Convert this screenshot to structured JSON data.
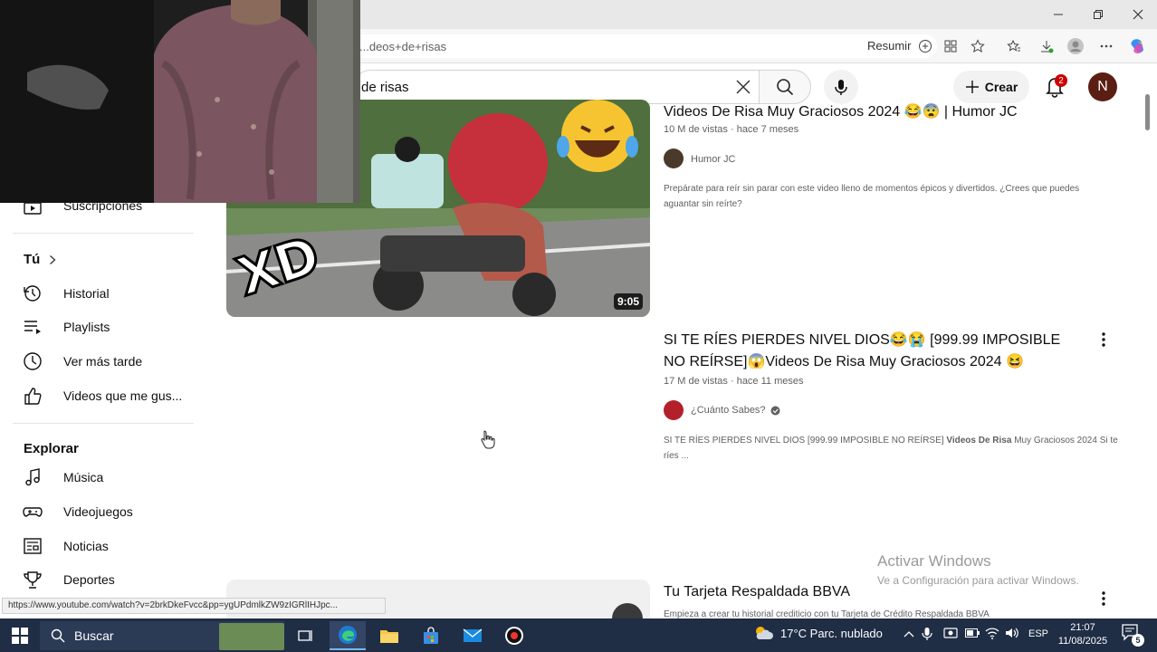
{
  "browser": {
    "url": "...deos+de+risas",
    "resume_label": "Resumir",
    "status_url": "https://www.youtube.com/watch?v=2brkDkeFvcc&pp=ygUPdmlkZW9zIGRlIHJpc..."
  },
  "header": {
    "search_value": "de risas",
    "create_label": "Crear",
    "notifications": "2",
    "avatar_letter": "N"
  },
  "sidebar": {
    "subscriptions_label": "Suscripciones",
    "you_heading": "Tú",
    "you_items": [
      {
        "label": "Historial",
        "icon": "history-icon"
      },
      {
        "label": "Playlists",
        "icon": "playlist-icon"
      },
      {
        "label": "Ver más tarde",
        "icon": "clock-icon"
      },
      {
        "label": "Videos que me gus...",
        "icon": "thumbs-up-icon"
      }
    ],
    "explore_heading": "Explorar",
    "explore_items": [
      {
        "label": "Música",
        "icon": "music-note-icon"
      },
      {
        "label": "Videojuegos",
        "icon": "gamepad-icon"
      },
      {
        "label": "Noticias",
        "icon": "newspaper-icon"
      },
      {
        "label": "Deportes",
        "icon": "trophy-icon"
      }
    ]
  },
  "videos": [
    {
      "title": "Videos De Risa Muy Graciosos 2024 😂😨 | Humor JC",
      "meta": "10 M de vistas · hace 7 meses",
      "channel": "Humor JC",
      "description": "Prepárate para reír sin parar con este video lleno de momentos épicos y divertidos. ¿Crees que puedes aguantar sin reírte?",
      "duration": "9:05",
      "thumb_text": "XD"
    },
    {
      "title": "SI TE RÍES PIERDES NIVEL DIOS😂😭 [999.99 IMPOSIBLE NO REÍRSE]😱Videos De Risa Muy Graciosos 2024 😆",
      "meta": "17 M de vistas · hace 11 meses",
      "channel": "¿Cuánto Sabes?",
      "description_bold": "SI TE RÍES PIERDES NIVEL DIOS [999.99 IMPOSIBLE NO REÍRSE] ",
      "description_strong": "Videos De Risa",
      "description_rest": " Muy Graciosos 2024 Si te ríes ..."
    },
    {
      "title": "Tu Tarjeta Respaldada BBVA",
      "description": "Empieza a crear tu historial crediticio con tu Tarjeta de Crédito Respaldada BBVA"
    }
  ],
  "watermark": {
    "line1": "Activar Windows",
    "line2": "Ve a Configuración para activar Windows."
  },
  "taskbar": {
    "search_placeholder": "Buscar",
    "weather": "17°C  Parc. nublado",
    "language": "ESP",
    "time": "21:07",
    "date": "11/08/2025",
    "notification_count": "5"
  },
  "colors": {
    "taskbar_bg": "#1f2d45",
    "notification_red": "#cc0000",
    "avatar_bg": "#5a1e12"
  }
}
